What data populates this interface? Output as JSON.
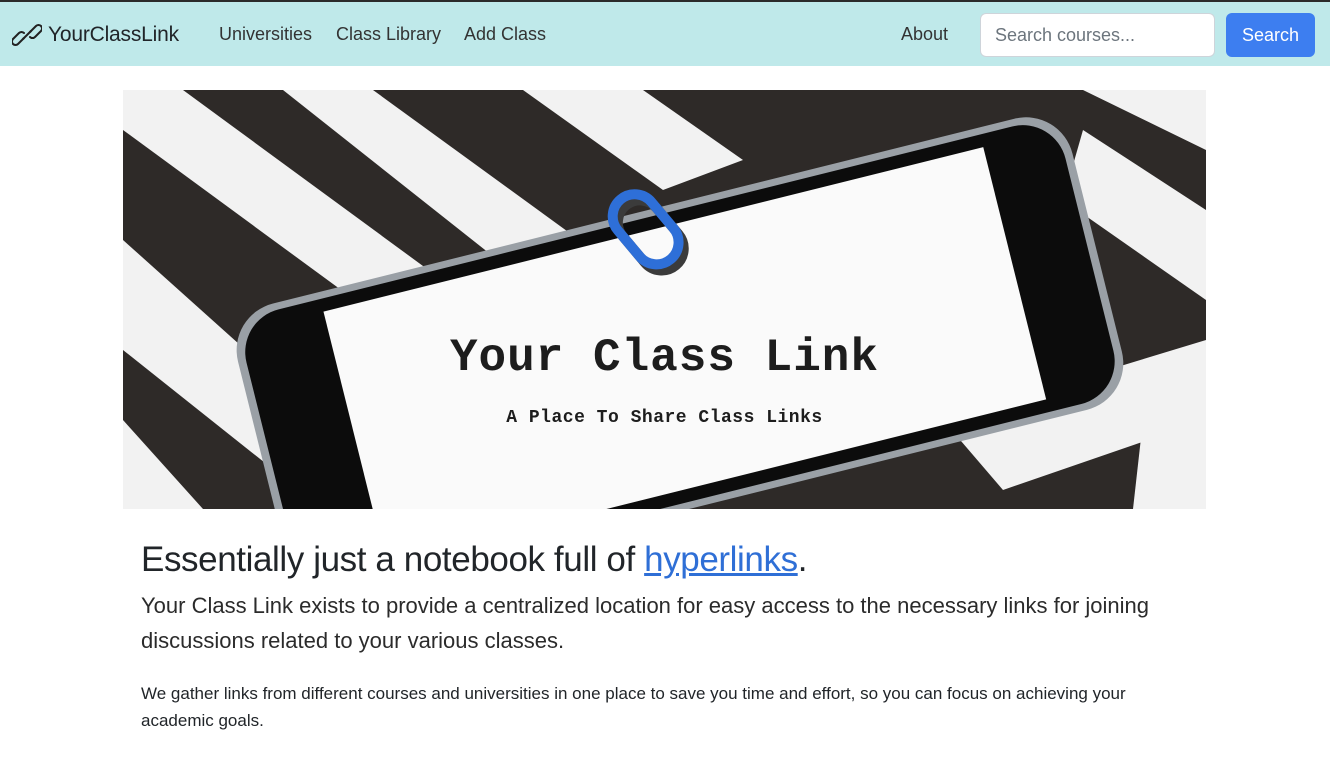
{
  "navbar": {
    "brand": "YourClassLink",
    "links": [
      "Universities",
      "Class Library",
      "Add Class"
    ],
    "about": "About",
    "search_placeholder": "Search courses...",
    "search_button": "Search",
    "background": "#bfe9ea",
    "accent": "#3d7ef0"
  },
  "hero": {
    "title": "Your Class Link",
    "subtitle": "A Place To Share Class Links",
    "icon": "link-chain-icon"
  },
  "main": {
    "headline_prefix": "Essentially just a notebook full of ",
    "headline_link": "hyperlinks",
    "headline_suffix": ".",
    "lead": "Your Class Link exists to provide a centralized location for easy access to the necessary links for joining discussions related to your various classes.",
    "body": "We gather links from different courses and universities in one place to save you time and effort, so you can focus on achieving your academic goals."
  }
}
